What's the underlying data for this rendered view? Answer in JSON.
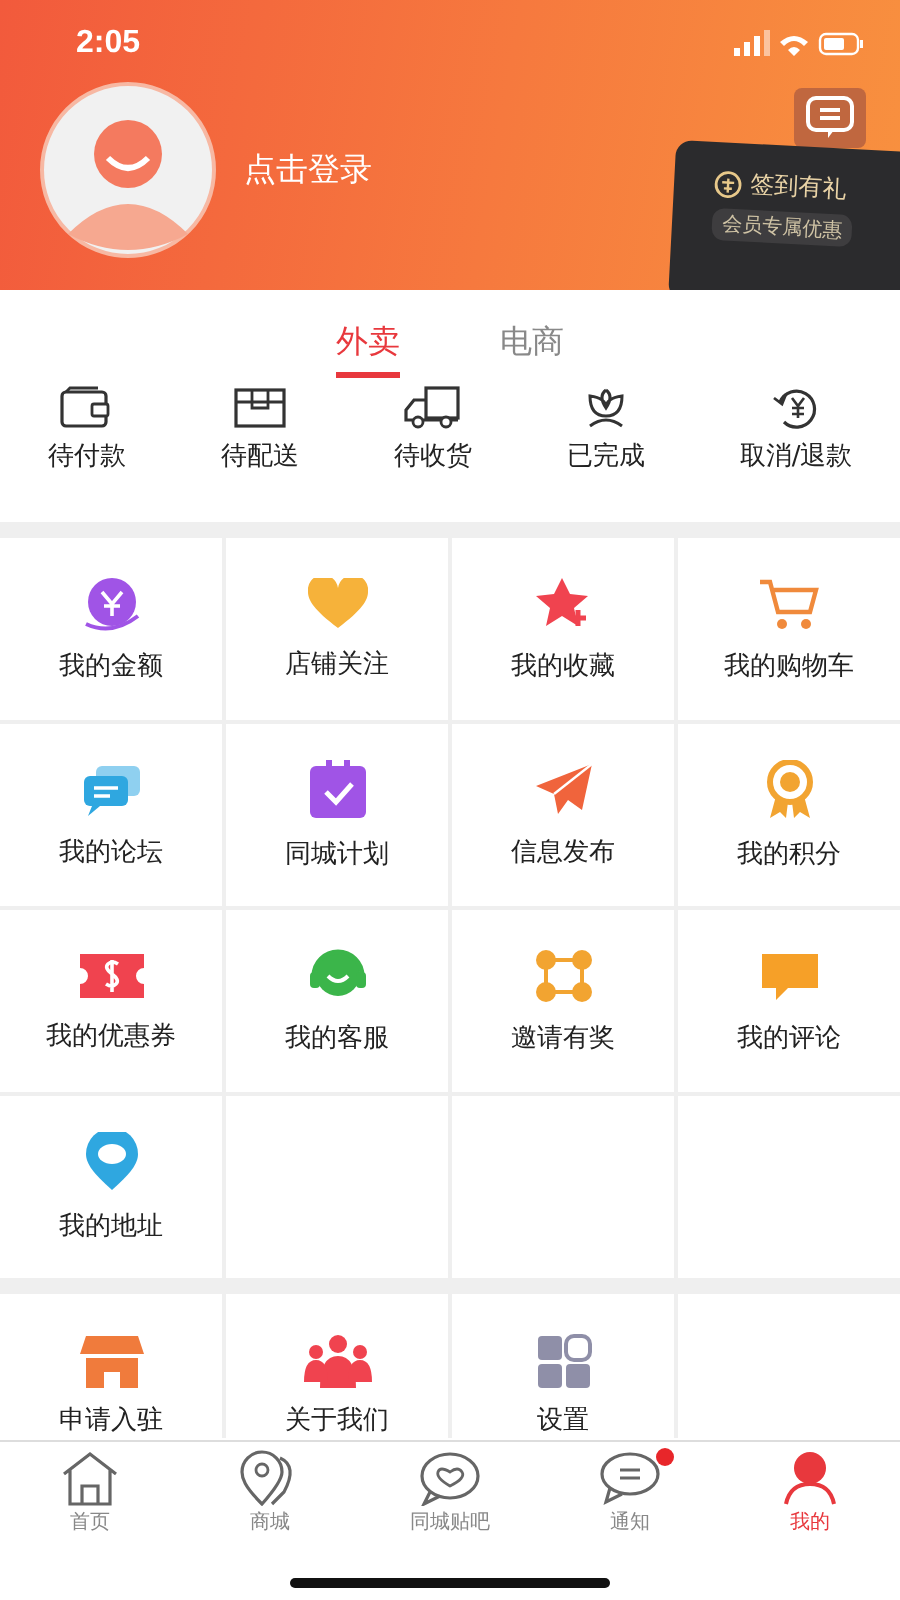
{
  "status_bar": {
    "time": "2:05"
  },
  "profile": {
    "login_label": "点击登录"
  },
  "sign_in_card": {
    "title": "签到有礼",
    "subtitle": "会员专属优惠"
  },
  "tabs": [
    {
      "label": "外卖",
      "selected": true
    },
    {
      "label": "电商",
      "selected": false
    }
  ],
  "order_status": [
    {
      "label": "待付款"
    },
    {
      "label": "待配送"
    },
    {
      "label": "待收货"
    },
    {
      "label": "已完成"
    },
    {
      "label": "取消/退款"
    }
  ],
  "services": [
    {
      "label": "我的金额"
    },
    {
      "label": "店铺关注"
    },
    {
      "label": "我的收藏"
    },
    {
      "label": "我的购物车"
    },
    {
      "label": "我的论坛"
    },
    {
      "label": "同城计划"
    },
    {
      "label": "信息发布"
    },
    {
      "label": "我的积分"
    },
    {
      "label": "我的优惠券"
    },
    {
      "label": "我的客服"
    },
    {
      "label": "邀请有奖"
    },
    {
      "label": "我的评论"
    },
    {
      "label": "我的地址"
    }
  ],
  "more": [
    {
      "label": "申请入驻"
    },
    {
      "label": "关于我们"
    },
    {
      "label": "设置"
    }
  ],
  "tab_bar": [
    {
      "label": "首页",
      "selected": false,
      "badge": false
    },
    {
      "label": "商城",
      "selected": false,
      "badge": false
    },
    {
      "label": "同城贴吧",
      "selected": false,
      "badge": false
    },
    {
      "label": "通知",
      "selected": false,
      "badge": true
    },
    {
      "label": "我的",
      "selected": true,
      "badge": false
    }
  ]
}
